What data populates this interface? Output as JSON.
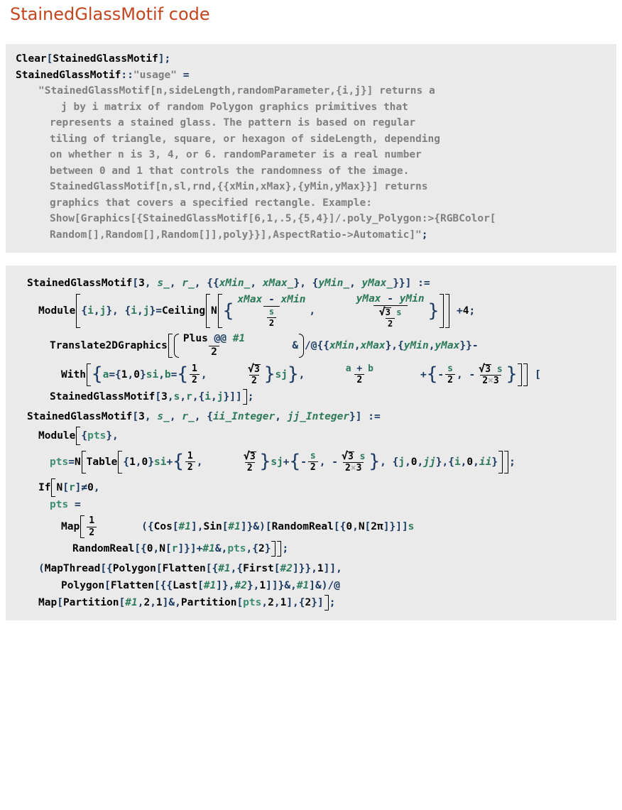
{
  "page": {
    "title": "StainedGlassMotif code",
    "title_color": "#C4441E",
    "cell_background": "#EAEAEA",
    "page_background": "#FFFFFF",
    "string_color": "#7F7F7F",
    "pattern_color": "#2C7A5A",
    "local_var_color": "#3C8C74"
  },
  "cells": [
    {
      "name": "usage-definition-cell",
      "lines": [
        "Clear[StainedGlassMotif];",
        "StainedGlassMotif::\"usage\" =",
        "\"StainedGlassMotif[n,sideLength,randomParameter,{i,j}] returns a",
        "j by i matrix of random Polygon graphics primitives that",
        "represents a stained glass. The pattern is based on regular",
        "tiling of triangle, square, or hexagon of sideLength, depending",
        "on whether n is 3, 4, or 6. randomParameter is a real number",
        "between 0 and 1 that controls the randomness of the image.",
        "StainedGlassMotif[n,sl,rnd,{{xMin,xMax},{yMin,yMax}}] returns",
        "graphics that covers a specified rectangle. Example:",
        "Show[Graphics[{StainedGlassMotif[6,1,.5,{5,4}]/.poly_Polygon:>{RGBColor[",
        "Random[],Random[],Random[]],poly}}],AspectRatio->Automatic]\";"
      ],
      "tokens": {
        "clear_head": "Clear",
        "symbol_name": "StainedGlassMotif",
        "message_tag": "\"usage\"",
        "assign": "=",
        "semicolon": ";"
      }
    },
    {
      "name": "main-definitions-cell",
      "definition_1": {
        "lhs": "StainedGlassMotif[3, s_, r_, {{xMin_, xMax_}, {yMin_, yMax_}}] :=",
        "head": "Module",
        "locals": "{i, j}",
        "ceiling_head": "Ceiling",
        "n_head": "N",
        "frac1_num": "xMax - xMin",
        "frac1_den_num": "s",
        "frac1_den_den": "2",
        "frac2_num": "yMax - yMin",
        "frac2_den_num": "√3 s",
        "frac2_den_den": "2",
        "plus_four": "+ 4;",
        "translate_head": "Translate2DGraphics",
        "plus_apply": "Plus @@ #1",
        "plus_apply_den": "2",
        "amp": "&",
        "map_at": "/@",
        "ranges": "{{xMin, xMax}, {yMin, yMax}}",
        "minus": "-",
        "with_head": "With",
        "a_def": "a = {1, 0} s i",
        "b_def_lead": "b = {",
        "b_half_num": "1",
        "b_half_den": "2",
        "b_sqrt_num": "√3",
        "b_sqrt_den": "2",
        "b_def_tail": "} s j},",
        "ab_num": "a + b",
        "ab_den": "2",
        "plus": "+",
        "neg_s_num": "s",
        "neg_s_den": "2",
        "neg_sq_num": "√3 s",
        "neg_sq_den": "2×3",
        "recursive_call": "StainedGlassMotif[3, s, r, {i, j}]]",
        "end_semicolon": ";"
      },
      "definition_2": {
        "lhs": "StainedGlassMotif[3, s_, r_, {ii_Integer, jj_Integer}] :=",
        "head": "Module",
        "locals": "{pts},",
        "pts_assign": "pts =",
        "n_head": "N",
        "table_head": "Table",
        "vec1": "{1, 0} s i +",
        "half_num": "1",
        "half_den": "2",
        "sqrt_num": "√3",
        "sqrt_den": "2",
        "vec2_tail": "} s j +",
        "off_s_num": "s",
        "off_s_den": "2",
        "off_sq_num": "√3 s",
        "off_sq_den": "2×3",
        "iter_j": "{j, 0, jj},",
        "iter_i": "{i, 0, ii}",
        "if_head": "If",
        "if_cond": "N[r] ≠ 0,",
        "pts_assign2": "pts =",
        "map_head": "Map",
        "map_half_num": "1",
        "map_half_den": "2",
        "cos_sin": "({Cos[#1], Sin[#1]} &)[RandomReal[{0, N[2 π]}]] s",
        "randomreal_line": "RandomReal[{0, N[r]}] + #1 &, pts, {2}",
        "mapthread_line1": "(MapThread[{Polygon[Flatten[{#1, {First[#2]}}, 1]],",
        "mapthread_line2": "Polygon[Flatten[{{Last[#1]}, #2}, 1]]} &, #1] &) /@",
        "mapthread_line3": "Map[Partition[#1, 2, 1] &, Partition[pts, 2, 1], {2}]",
        "end_semicolon": ";"
      }
    }
  ]
}
